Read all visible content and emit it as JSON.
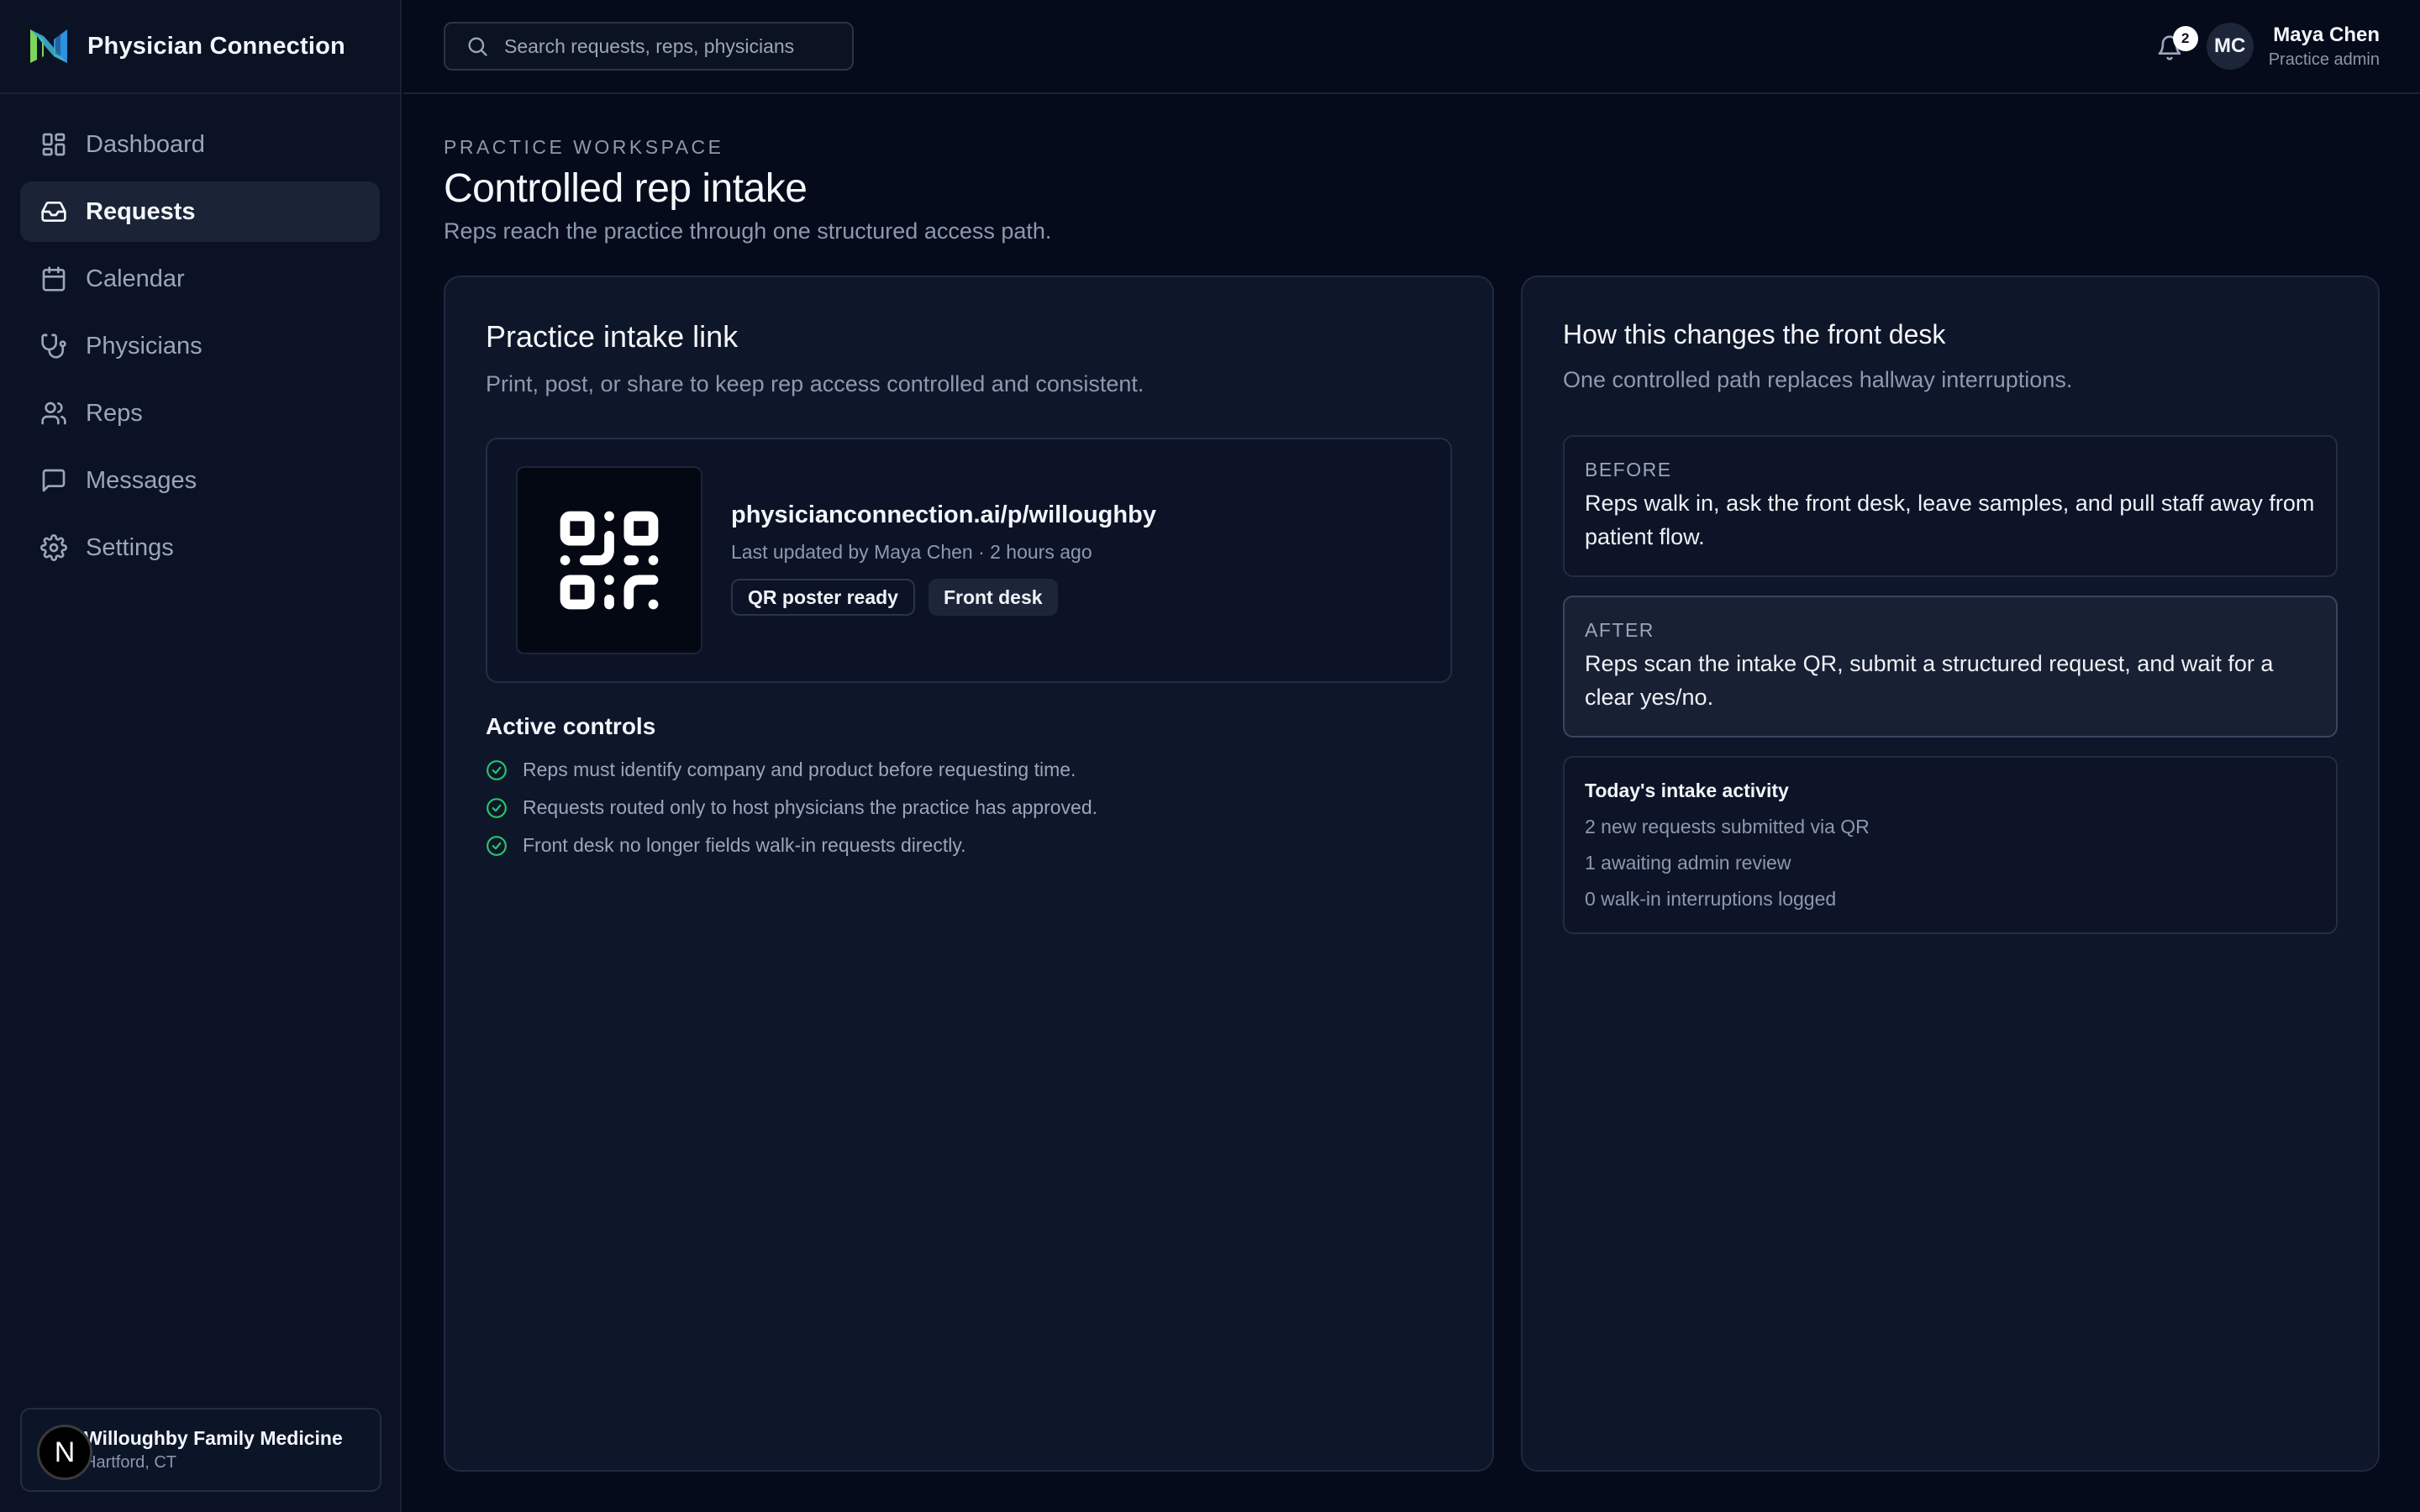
{
  "brand": {
    "name": "Physician Connection",
    "logo_icon": "physician-connection-logo"
  },
  "sidebar": {
    "items": [
      {
        "label": "Dashboard",
        "icon": "dashboard-icon",
        "active": false
      },
      {
        "label": "Requests",
        "icon": "inbox-icon",
        "active": true
      },
      {
        "label": "Calendar",
        "icon": "calendar-icon",
        "active": false
      },
      {
        "label": "Physicians",
        "icon": "stethoscope-icon",
        "active": false
      },
      {
        "label": "Reps",
        "icon": "users-icon",
        "active": false
      },
      {
        "label": "Messages",
        "icon": "message-icon",
        "active": false
      },
      {
        "label": "Settings",
        "icon": "gear-icon",
        "active": false
      }
    ],
    "practice": {
      "badge": "N",
      "name": "Willoughby Family Medicine",
      "location": "Hartford, CT"
    }
  },
  "header": {
    "search_placeholder": "Search requests, reps, physicians",
    "notification_count": "2",
    "user": {
      "initials": "MC",
      "name": "Maya Chen",
      "role": "Practice admin"
    }
  },
  "page": {
    "eyebrow": "PRACTICE WORKSPACE",
    "title": "Controlled rep intake",
    "subtitle": "Reps reach the practice through one structured access path."
  },
  "intake": {
    "title": "Practice intake link",
    "description": "Print, post, or share to keep rep access controlled and consistent.",
    "url": "physicianconnection.ai/p/willoughby",
    "meta": "Last updated by Maya Chen · 2 hours ago",
    "chips": [
      "QR poster ready",
      "Front desk"
    ],
    "controls_title": "Active controls",
    "controls": [
      "Reps must identify company and product before requesting time.",
      "Requests routed only to host physicians the practice has approved.",
      "Front desk no longer fields walk-in requests directly."
    ]
  },
  "front_desk": {
    "title": "How this changes the front desk",
    "description": "One controlled path replaces hallway interruptions.",
    "before": {
      "tag": "BEFORE",
      "text": "Reps walk in, ask the front desk, leave samples, and pull staff away from patient flow."
    },
    "after": {
      "tag": "AFTER",
      "text": "Reps scan the intake QR, submit a structured request, and wait for a clear yes/no."
    },
    "activity": {
      "title": "Today's intake activity",
      "items": [
        "2 new requests submitted via QR",
        "1 awaiting admin review",
        "0 walk-in interruptions logged"
      ]
    }
  },
  "colors": {
    "background": "#050b1a",
    "card": "#0e1629",
    "accent_check": "#27c46a",
    "logo_green": "#7bd65a",
    "logo_blue": "#2f8fe0"
  }
}
